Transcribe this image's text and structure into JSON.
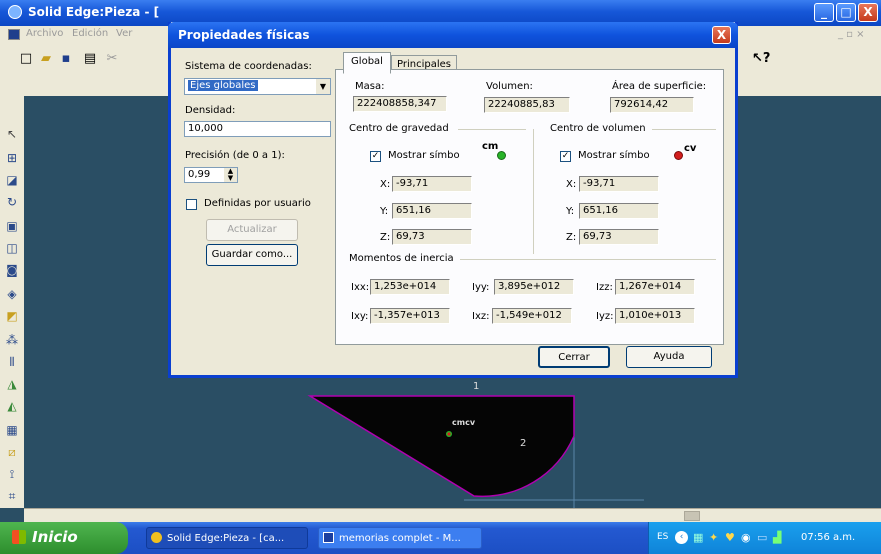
{
  "app": {
    "title": "Solid Edge:Pieza - ["
  },
  "window_buttons": {
    "minimize": "_",
    "maximize": "□",
    "close": "X"
  },
  "menubar": {
    "items": [
      "Archivo",
      "Edición",
      "Ver"
    ]
  },
  "dialog": {
    "title": "Propiedades físicas",
    "close": "X",
    "coord_system_label": "Sistema de coordenadas:",
    "coord_system_value": "Ejes globales",
    "density_label": "Densidad:",
    "density_value": "10,000",
    "precision_label": "Precisión (de 0 a 1):",
    "precision_value": "0,99",
    "user_defined_label": "Definidas por usuario",
    "update_button": "Actualizar",
    "save_as_button": "Guardar como...",
    "tabs": [
      {
        "label": "Global",
        "active": true
      },
      {
        "label": "Principales",
        "active": false
      }
    ],
    "mass_label": "Masa:",
    "mass_value": "222408858,347",
    "volume_label": "Volumen:",
    "volume_value": "22240885,83",
    "area_label": "Área de superficie:",
    "area_value": "792614,42",
    "cog": {
      "title": "Centro de gravedad",
      "show_symbol": "Mostrar símbolo",
      "symbol_text": "cm",
      "x_label": "X:",
      "x_value": "-93,71",
      "y_label": "Y:",
      "y_value": "651,16",
      "z_label": "Z:",
      "z_value": "69,73"
    },
    "cov": {
      "title": "Centro de volumen",
      "show_symbol": "Mostrar símbolo",
      "symbol_text": "cv",
      "x_label": "X:",
      "x_value": "-93,71",
      "y_label": "Y:",
      "y_value": "651,16",
      "z_label": "Z:",
      "z_value": "69,73"
    },
    "inertia": {
      "title": "Momentos de inercia",
      "ixx_label": "Ixx:",
      "ixx_value": "1,253e+014",
      "iyy_label": "Iyy:",
      "iyy_value": "3,895e+012",
      "izz_label": "Izz:",
      "izz_value": "1,267e+014",
      "ixy_label": "Ixy:",
      "ixy_value": "-1,357e+013",
      "ixz_label": "Ixz:",
      "ixz_value": "-1,549e+012",
      "iyz_label": "Iyz:",
      "iyz_value": "1,010e+013"
    },
    "close_button": "Cerrar",
    "help_button": "Ayuda"
  },
  "canvas": {
    "label_1": "1",
    "label_2": "2",
    "marker_text": "cmcv"
  },
  "taskbar": {
    "start": "Inicio",
    "tasks": [
      "Solid Edge:Pieza - [ca...",
      "memorias complet - M..."
    ],
    "lang": "ES",
    "clock": "07:56 a.m."
  },
  "colors": {
    "accent": "#0a46c8",
    "cog_dot": "#28b428",
    "cov_dot": "#d21e1e",
    "part_edge": "#b000b0"
  }
}
